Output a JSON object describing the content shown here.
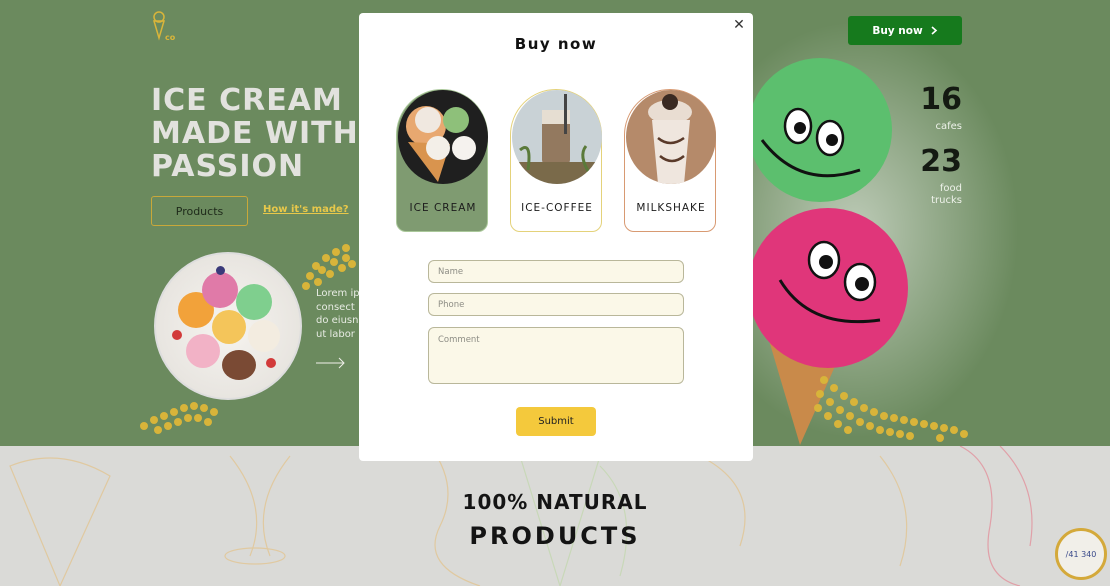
{
  "header": {
    "logo_name": "ice-cream-cone-logo",
    "buy_now_label": "Buy now",
    "buy_now_icon": "chevron-right-icon"
  },
  "hero": {
    "title_lines": [
      "ICE CREAM",
      "MADE WITH",
      "PASSION"
    ],
    "products_button": "Products",
    "how_link": "How it's made?",
    "lorem_lines": [
      "Lorem ip",
      "consect",
      "do eiusn",
      "ut labor"
    ],
    "arrow_icon": "arrow-right-icon"
  },
  "stats": [
    {
      "value": "16",
      "label": "cafes"
    },
    {
      "value": "23",
      "label_lines": [
        "food",
        "trucks"
      ]
    }
  ],
  "section": {
    "line1": "100% NATURAL",
    "line2": "PRODUCTS"
  },
  "badge": {
    "text": "/41 340"
  },
  "modal": {
    "title": "Buy now",
    "close_icon": "close-icon",
    "choices": [
      {
        "label": "ICE CREAM",
        "selected": true
      },
      {
        "label": "ICE-COFFEE",
        "selected": false
      },
      {
        "label": "MILKSHAKE",
        "selected": false
      }
    ],
    "form": {
      "name_placeholder": "Name",
      "phone_placeholder": "Phone",
      "comment_placeholder": "Comment",
      "submit_label": "Submit"
    }
  },
  "colors": {
    "hero_bg": "#6b8a5e",
    "accent_yellow": "#f4c93c",
    "buy_button": "#167a1d",
    "selected_choice": "#7f9b71"
  }
}
